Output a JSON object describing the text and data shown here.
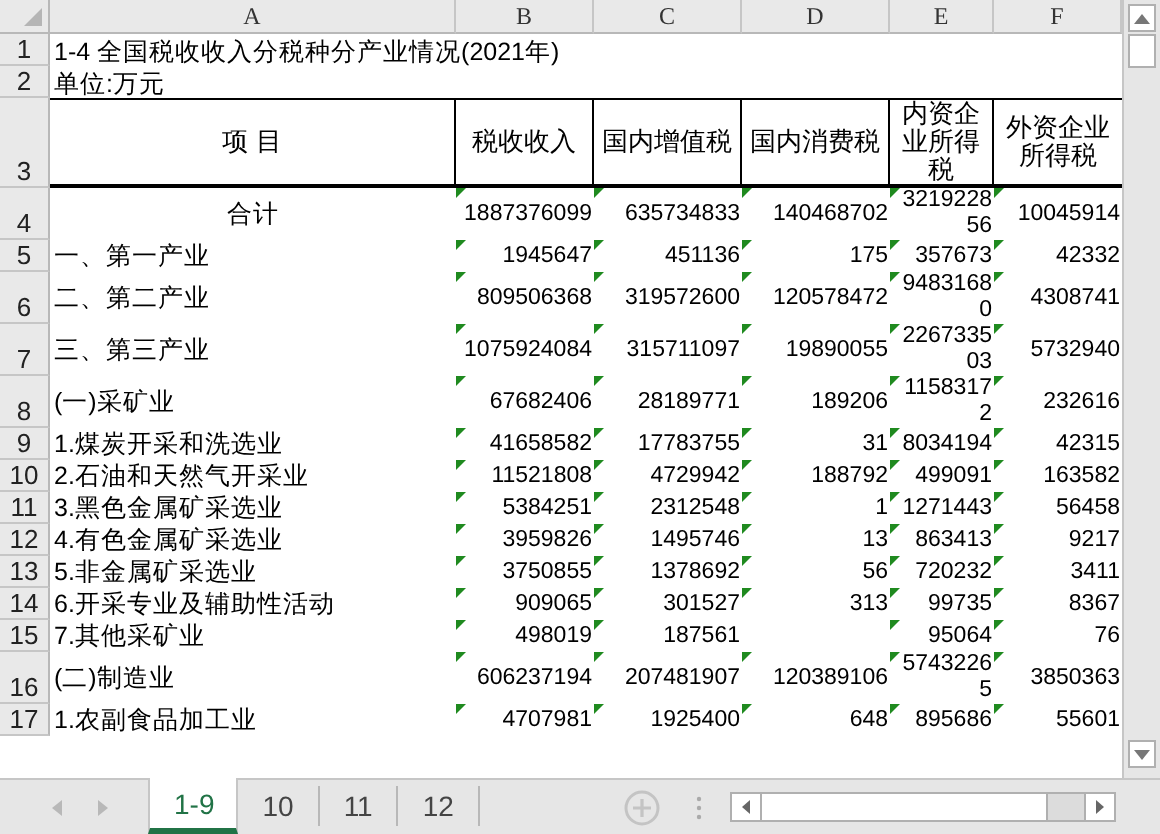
{
  "sheet": {
    "column_headers": [
      "A",
      "B",
      "C",
      "D",
      "E",
      "F"
    ],
    "row_numbers": [
      "1",
      "2",
      "3",
      "4",
      "5",
      "6",
      "7",
      "8",
      "9",
      "10",
      "11",
      "12",
      "13",
      "14",
      "15",
      "16",
      "17"
    ],
    "title": "1-4 全国税收收入分税种分产业情况(2021年)",
    "unit": "单位:万元",
    "header_cells": [
      "项 目",
      "税收收入",
      "国内增值税",
      "国内消费税",
      "内资企业所得税",
      "外资企业所得税"
    ],
    "rows": [
      {
        "kind": "total",
        "label": "合计",
        "column_b": "1887376099",
        "column_c": "635734833",
        "column_d": "140468702",
        "column_e": "321922856",
        "column_f": "10045914"
      },
      {
        "kind": "item",
        "label": "一、第一产业",
        "column_b": "1945647",
        "column_c": "451136",
        "column_d": "175",
        "column_e": "357673",
        "column_f": "42332"
      },
      {
        "kind": "item",
        "label": "二、第二产业",
        "column_b": "809506368",
        "column_c": "319572600",
        "column_d": "120578472",
        "column_e": "94831680",
        "column_f": "4308741"
      },
      {
        "kind": "item",
        "label": "三、第三产业",
        "column_b": "1075924084",
        "column_c": "315711097",
        "column_d": "19890055",
        "column_e": "226733503",
        "column_f": "5732940"
      },
      {
        "kind": "item",
        "label": "(一)采矿业",
        "column_b": "67682406",
        "column_c": "28189771",
        "column_d": "189206",
        "column_e": "11583172",
        "column_f": "232616"
      },
      {
        "kind": "item",
        "label": "1.煤炭开采和洗选业",
        "column_b": "41658582",
        "column_c": "17783755",
        "column_d": "31",
        "column_e": "8034194",
        "column_f": "42315"
      },
      {
        "kind": "item",
        "label": "2.石油和天然气开采业",
        "column_b": "11521808",
        "column_c": "4729942",
        "column_d": "188792",
        "column_e": "499091",
        "column_f": "163582"
      },
      {
        "kind": "item",
        "label": "3.黑色金属矿采选业",
        "column_b": "5384251",
        "column_c": "2312548",
        "column_d": "1",
        "column_e": "1271443",
        "column_f": "56458"
      },
      {
        "kind": "item",
        "label": "4.有色金属矿采选业",
        "column_b": "3959826",
        "column_c": "1495746",
        "column_d": "13",
        "column_e": "863413",
        "column_f": "9217"
      },
      {
        "kind": "item",
        "label": "5.非金属矿采选业",
        "column_b": "3750855",
        "column_c": "1378692",
        "column_d": "56",
        "column_e": "720232",
        "column_f": "3411"
      },
      {
        "kind": "item",
        "label": "6.开采专业及辅助性活动",
        "column_b": "909065",
        "column_c": "301527",
        "column_d": "313",
        "column_e": "99735",
        "column_f": "8367"
      },
      {
        "kind": "item",
        "label": "7.其他采矿业",
        "column_b": "498019",
        "column_c": "187561",
        "column_e": "95064",
        "column_f": "76"
      },
      {
        "kind": "item",
        "label": "(二)制造业",
        "column_b": "606237194",
        "column_c": "207481907",
        "column_d": "120389106",
        "column_e": "57432265",
        "column_f": "3850363"
      },
      {
        "kind": "item",
        "label": "1.农副食品加工业",
        "column_b": "4707981",
        "column_c": "1925400",
        "column_d": "648",
        "column_e": "895686",
        "column_f": "55601"
      }
    ]
  },
  "sheet_tabs": [
    {
      "label": "1-9",
      "selected": true
    },
    {
      "label": "10",
      "selected": false
    },
    {
      "label": "11",
      "selected": false
    },
    {
      "label": "12",
      "selected": false
    }
  ]
}
